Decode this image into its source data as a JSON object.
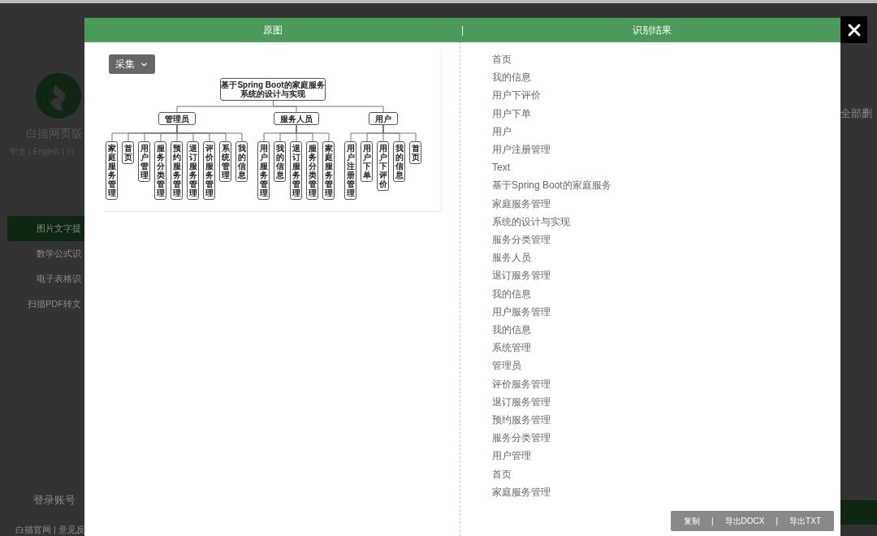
{
  "background_page": {
    "brand": "白描网页版",
    "languages": "中文 | English | 日",
    "menu": [
      {
        "label": "图片文字提",
        "selected": true
      },
      {
        "label": "数学公式识",
        "selected": false
      },
      {
        "label": "电子表格识",
        "selected": false
      },
      {
        "label": "扫描PDF转文",
        "selected": false
      }
    ],
    "login": "登录账号",
    "footer": "白描官网 | 意见反",
    "right_action": "全部删"
  },
  "dialog": {
    "header": {
      "left": "原图",
      "separator": "|",
      "right": "识别结果"
    },
    "collect_button": "采集",
    "diagram": {
      "lines": [
        "基于Spring Boot的家庭服务",
        "系统的设计与实现"
      ],
      "children": [
        {
          "label": "管理员",
          "children": [
            {
              "label": "家庭服务管理"
            },
            {
              "label": "首页"
            },
            {
              "label": "用户管理"
            },
            {
              "label": "服务分类管理"
            },
            {
              "label": "预约服务管理"
            },
            {
              "label": "退订服务管理"
            },
            {
              "label": "评价服务管理"
            },
            {
              "label": "系统管理"
            },
            {
              "label": "我的信息"
            }
          ]
        },
        {
          "label": "服务人员",
          "children": [
            {
              "label": "用户服务管理"
            },
            {
              "label": "我的信息"
            },
            {
              "label": "退订服务管理"
            },
            {
              "label": "服务分类管理"
            },
            {
              "label": "家庭服务管理"
            }
          ]
        },
        {
          "label": "用户",
          "children": [
            {
              "label": "用户注册管理"
            },
            {
              "label": "用户下单"
            },
            {
              "label": "用户下评价"
            },
            {
              "label": "我的信息"
            },
            {
              "label": "首页"
            }
          ]
        }
      ]
    },
    "results": [
      "首页",
      "我的信息",
      "用户下评价",
      "用户下单",
      "用户",
      "用户注册管理",
      "Text",
      "基于Spring Boot的家庭服务",
      "家庭服务管理",
      "系统的设计与实现",
      "服务分类管理",
      "服务人员",
      "退订服务管理",
      "我的信息",
      "用户服务管理",
      "我的信息",
      "系统管理",
      "管理员",
      "评价服务管理",
      "退订服务管理",
      "预约服务管理",
      "服务分类管理",
      "用户管理",
      "首页",
      "家庭服务管理"
    ],
    "actions": [
      "复制",
      "导出DOCX",
      "导出TXT"
    ],
    "action_separator": "|"
  }
}
